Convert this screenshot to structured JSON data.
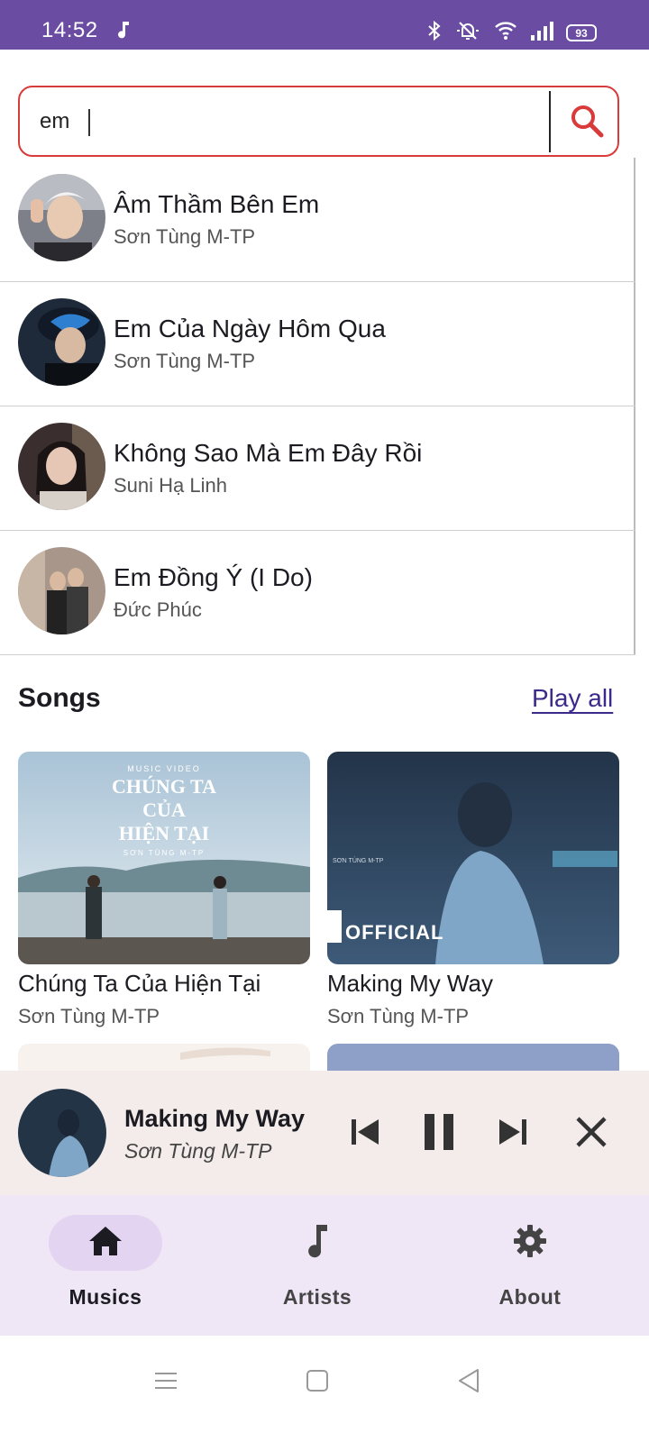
{
  "status_bar": {
    "time": "14:52",
    "battery": "93",
    "icons": [
      "music-note-icon",
      "bluetooth-icon",
      "mute-bell-icon",
      "wifi-icon",
      "signal-icon",
      "battery-icon"
    ]
  },
  "search": {
    "value": "em",
    "icon": "search-icon",
    "accent": "#d93a3a"
  },
  "suggestions": [
    {
      "title": "Âm Thầm Bên Em",
      "artist": "Sơn Tùng M-TP"
    },
    {
      "title": "Em Của Ngày Hôm Qua",
      "artist": "Sơn Tùng M-TP"
    },
    {
      "title": "Không Sao Mà Em Đây Rồi",
      "artist": "Suni Hạ Linh"
    },
    {
      "title": "Em Đồng Ý (I Do)",
      "artist": "Đức Phúc"
    }
  ],
  "songs_section": {
    "heading": "Songs",
    "play_all": "Play all",
    "items": [
      {
        "title": "Chúng Ta Của Hiện Tại",
        "artist": "Sơn Tùng M-TP",
        "thumb_top": "MUSIC VIDEO",
        "thumb_line1": "CHÚNG TA",
        "thumb_line2": "CỦA",
        "thumb_line3": "HIỆN TẠI",
        "thumb_sub": "SƠN TÙNG M-TP"
      },
      {
        "title": "Making My Way",
        "artist": "Sơn Tùng M-TP",
        "thumb_badge": "OFFICIAL",
        "thumb_label": "SƠN TÙNG M-TP"
      }
    ]
  },
  "mini_player": {
    "title": "Making My Way",
    "artist": "Sơn Tùng M-TP",
    "background": "#f3ecea"
  },
  "bottom_nav": {
    "items": [
      {
        "label": "Musics",
        "icon": "home-icon",
        "active": true
      },
      {
        "label": "Artists",
        "icon": "music-note-icon",
        "active": false
      },
      {
        "label": "About",
        "icon": "gear-icon",
        "active": false
      }
    ]
  },
  "colors": {
    "status_bar": "#6a4ca3",
    "nav_background": "#efe7f5",
    "nav_active_pill": "#e3d4f2",
    "link": "#3b2a8a"
  }
}
